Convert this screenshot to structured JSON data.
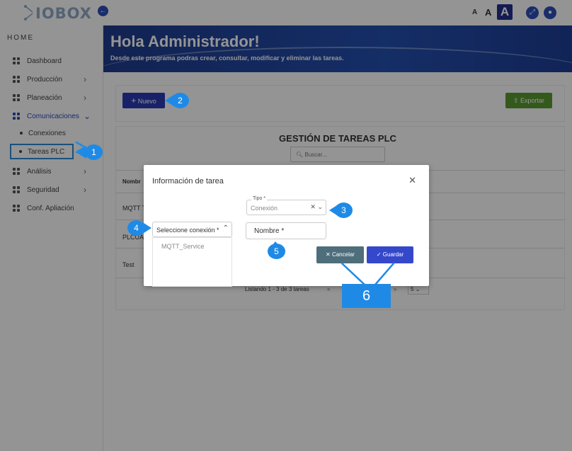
{
  "header": {
    "logo_text": "IOBOX",
    "font_small": "A",
    "font_medium": "A",
    "font_large": "A"
  },
  "sidebar": {
    "section": "HOME",
    "items": [
      {
        "label": "Dashboard"
      },
      {
        "label": "Producción"
      },
      {
        "label": "Planeación"
      },
      {
        "label": "Comunicaciones"
      },
      {
        "label": "Análisis"
      },
      {
        "label": "Seguridad"
      },
      {
        "label": "Conf. Apliación"
      }
    ],
    "subitems": [
      {
        "label": "Conexiones"
      },
      {
        "label": "Tareas PLC"
      }
    ]
  },
  "banner": {
    "title": "Hola Administrador!",
    "subtitle": "Desde este programa podras crear, consultar, modificar y eliminar las tareas."
  },
  "toolbar": {
    "new_label": "Nuevo",
    "export_label": "Exportar"
  },
  "table": {
    "title": "GESTIÓN DE TAREAS PLC",
    "search_placeholder": "Buscar...",
    "col_header": "Nombr",
    "rows": [
      "MQTT T",
      "PLCUA",
      "Test"
    ],
    "pagination_text": "Listando 1 - 3 de 3 tareas",
    "page_size": "5"
  },
  "modal": {
    "title": "Información de tarea",
    "tipo_label": "Tipo *",
    "tipo_value": "Conexión",
    "conexion_placeholder": "Seleccione conexión *",
    "conexion_option": "MQTT_Service",
    "nombre_placeholder": "Nombre *",
    "cancel_label": "Cancelar",
    "save_label": "Guardar"
  },
  "annotations": {
    "b1": "1",
    "b2": "2",
    "b3": "3",
    "b4": "4",
    "b5": "5",
    "b6": "6"
  },
  "colors": {
    "primary": "#2c3cb5",
    "export": "#5a9a32",
    "cancel": "#4e6e7c",
    "annotation": "#1f8ae6"
  }
}
